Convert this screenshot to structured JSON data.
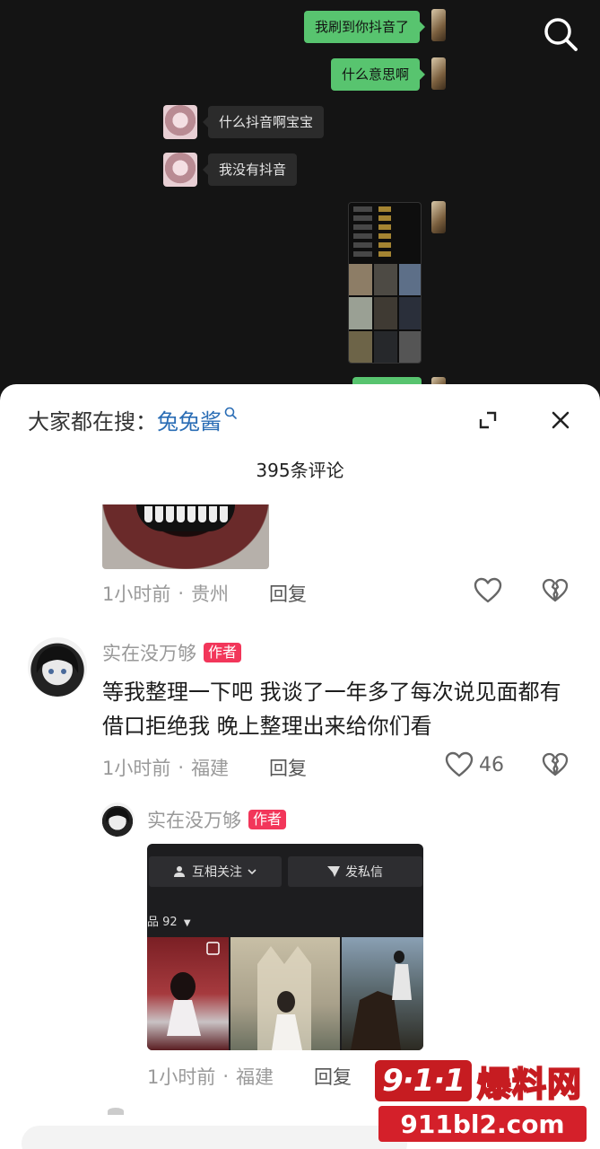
{
  "chat": {
    "messages": [
      {
        "side": "out",
        "text": "我刷到你抖音了"
      },
      {
        "side": "out",
        "text": "什么意思啊"
      },
      {
        "side": "in",
        "text": "什么抖音啊宝宝"
      },
      {
        "side": "in",
        "text": "我没有抖音"
      },
      {
        "side": "out",
        "type": "image"
      }
    ],
    "search_icon": "search-icon"
  },
  "sheet": {
    "search_prefix": "大家都在搜：",
    "search_keyword": "兔兔酱",
    "comment_count": "395条评论",
    "expand_icon": "expand-icon",
    "close_icon": "close-icon"
  },
  "comments": [
    {
      "time": "1小时前",
      "location": "贵州",
      "reply_label": "回复",
      "likes": ""
    },
    {
      "username": "实在没万够",
      "badge": "作者",
      "text": "等我整理一下吧 我谈了一年多了每次说见面都有借口拒绝我 晚上整理出来给你们看",
      "time": "1小时前",
      "location": "福建",
      "reply_label": "回复",
      "likes": "46"
    },
    {
      "username": "实在没万够",
      "badge": "作者",
      "time": "1小时前",
      "location": "福建",
      "reply_label": "回复",
      "image": {
        "follow_label": "互相关注",
        "message_label": "发私信",
        "works_label": "品 92"
      }
    }
  ],
  "separator": "·",
  "watermark": {
    "logo": "9·1·1",
    "title": "爆料网",
    "url": "911bl2.com"
  },
  "colors": {
    "accent_red": "#f2365a",
    "bubble_green": "#58c46f",
    "link_blue": "#2a6db5"
  }
}
